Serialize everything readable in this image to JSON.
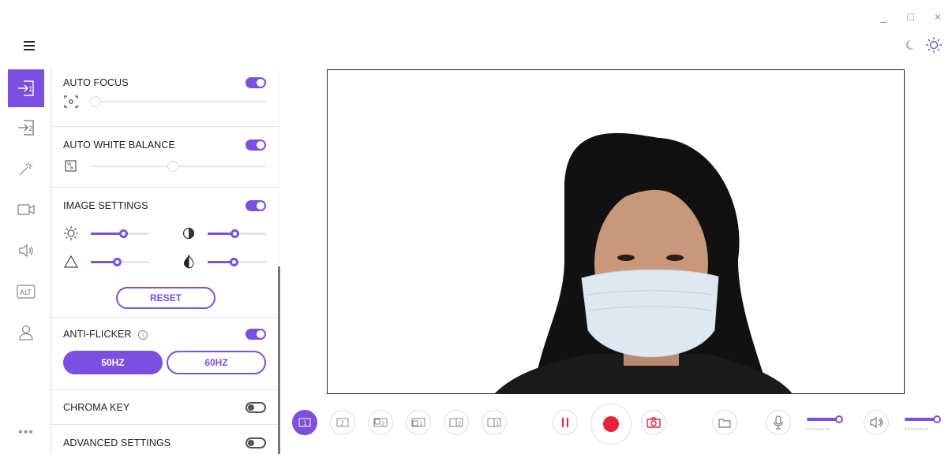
{
  "window_controls": {
    "minimize": "_",
    "maximize": "□",
    "close": "×"
  },
  "panel": {
    "auto_focus": {
      "label": "AUTO FOCUS",
      "enabled": true,
      "value": 0.0
    },
    "auto_white_balance": {
      "label": "AUTO WHITE BALANCE",
      "enabled": true,
      "value": 0.44
    },
    "image_settings": {
      "label": "IMAGE SETTINGS",
      "enabled": true,
      "brightness": 0.55,
      "contrast": 0.46,
      "saturation": 0.45,
      "sharpness": 0.45,
      "reset_label": "RESET"
    },
    "anti_flicker": {
      "label": "ANTI-FLICKER",
      "enabled": true,
      "option_50": "50HZ",
      "option_60": "60HZ",
      "selected": "50HZ"
    },
    "chroma_key": {
      "label": "CHROMA KEY",
      "enabled": false
    },
    "advanced_settings": {
      "label": "ADVANCED SETTINGS",
      "enabled": false
    }
  },
  "layouts": [
    "1",
    "2",
    "1 2",
    "2 1",
    "1 2",
    "2 1"
  ],
  "mic_volume": 0.95,
  "speaker_volume": 0.95,
  "accent": "#7b4fe0",
  "record_color": "#e8223c"
}
